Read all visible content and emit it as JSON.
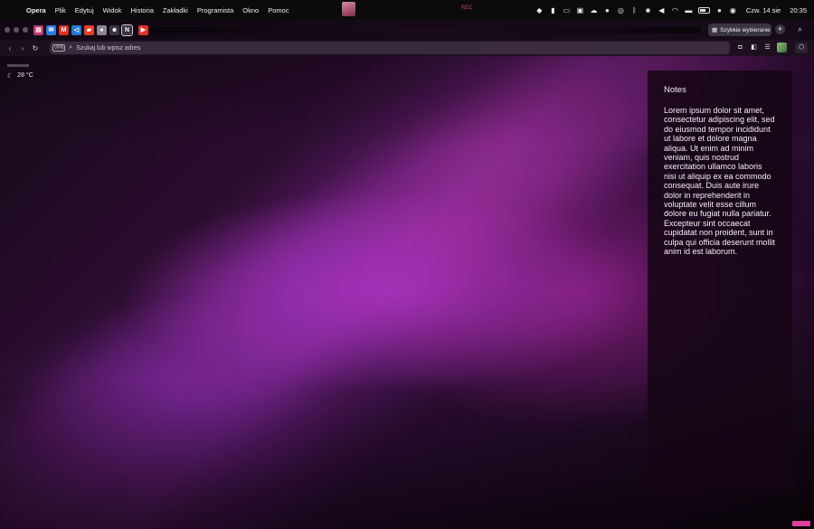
{
  "menubar": {
    "app_name": "Opera",
    "items": [
      "Plik",
      "Edytuj",
      "Widok",
      "Historia",
      "Zakładki",
      "Programista",
      "Okno",
      "Pomoc"
    ],
    "recording_label": "REC",
    "date": "Czw. 14 sie",
    "time": "20:35"
  },
  "browser": {
    "tabs": [
      {
        "icon": "ticket-icon",
        "color": "#c0356f"
      },
      {
        "icon": "mail-icon",
        "color": "#2c7be5"
      },
      {
        "icon": "gmail-icon",
        "color": "#d93025"
      },
      {
        "icon": "vscode-icon",
        "color": "#1f7ad6"
      },
      {
        "icon": "app-red-icon",
        "color": "#e2412a"
      },
      {
        "icon": "circle-icon",
        "color": "#8a8390"
      },
      {
        "icon": "assistant-icon",
        "color": "#3b3340"
      },
      {
        "icon": "notion-icon",
        "color": "#3b3340"
      },
      {
        "icon": "youtube-icon",
        "color": "#e0302a"
      }
    ],
    "speed_dial_label": "Szybkie wybieranie",
    "address_placeholder": "Szukaj lub wpisz adres",
    "vpn_label": "VPN"
  },
  "weather": {
    "temperature": "28 °C"
  },
  "notes": {
    "title": "Notes",
    "body": "Lorem ipsum dolor sit amet, consectetur adipiscing elit, sed do eiusmod tempor incididunt ut labore et dolore magna aliqua. Ut enim ad minim veniam, quis nostrud exercitation ullamco laboris nisi ut aliquip ex ea commodo consequat. Duis aute irure dolor in reprehenderit in voluptate velit esse cillum dolore eu fugiat nulla pariatur. Excepteur sint occaecat cupidatat non proident, sunt in culpa qui officia deserunt mollit anim id est laborum."
  }
}
